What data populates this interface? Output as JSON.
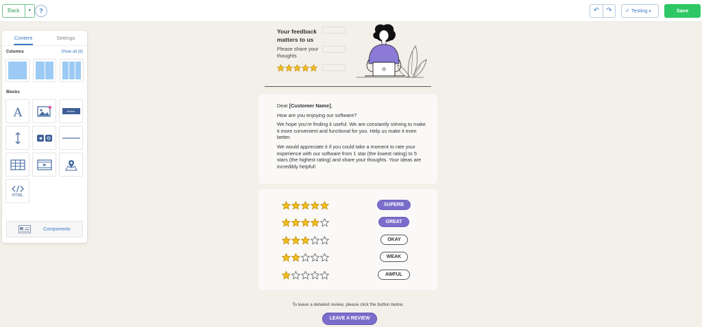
{
  "toolbar": {
    "back_label": "Back",
    "help_label": "?",
    "testing_label": "Testing",
    "save_label": "Save"
  },
  "panel": {
    "tabs": [
      {
        "label": "Content",
        "active": true
      },
      {
        "label": "Settings",
        "active": false
      }
    ],
    "columns_label": "Columns",
    "show_all_label": "Show all (6)",
    "blocks_label": "Blocks",
    "blocks": [
      {
        "icon": "text-icon"
      },
      {
        "icon": "image-icon"
      },
      {
        "icon": "button-block-icon",
        "label": "button"
      },
      {
        "icon": "spacer-icon"
      },
      {
        "icon": "social-icon"
      },
      {
        "icon": "divider-icon"
      },
      {
        "icon": "table-icon"
      },
      {
        "icon": "video-icon"
      },
      {
        "icon": "map-icon"
      },
      {
        "icon": "html-icon",
        "label": "HTML"
      }
    ],
    "components_label": "Components"
  },
  "email": {
    "header": {
      "title": "Your feedback matters to us",
      "subtitle": "Please share your thoughts",
      "stars": 5
    },
    "letter": {
      "greeting_prefix": "Dear ",
      "greeting_name": "[Customer Name]",
      "greeting_suffix": ",",
      "p1": "How are you enjoying our software?",
      "p2": "We hope you're finding it useful. We are constantly striving to make it more convenient and functional for you. Help us make it even better.",
      "p3": "We would appreciate it if you could take a moment to rate your experience with our software from 1 star (the lowest rating) to 5 stars (the highest rating) and share your thoughts. Your ideas are incredibly helpful!"
    },
    "ratings": [
      {
        "stars": 5,
        "label": "SUPERB",
        "style": "filled"
      },
      {
        "stars": 4,
        "label": "GREAT",
        "style": "filled"
      },
      {
        "stars": 3,
        "label": "OKAY",
        "style": "outline"
      },
      {
        "stars": 2,
        "label": "WEAK",
        "style": "outline"
      },
      {
        "stars": 1,
        "label": "AWFUL",
        "style": "outline"
      }
    ],
    "footer_text": "To leave a detailed review, please click the button below.",
    "cta_label": "LEAVE A REVIEW"
  },
  "colors": {
    "accent": "#3b78c4",
    "save": "#2ec765",
    "purple": "#7b6ecb",
    "star": "#f2c01d",
    "canvas": "#f3efe9"
  }
}
